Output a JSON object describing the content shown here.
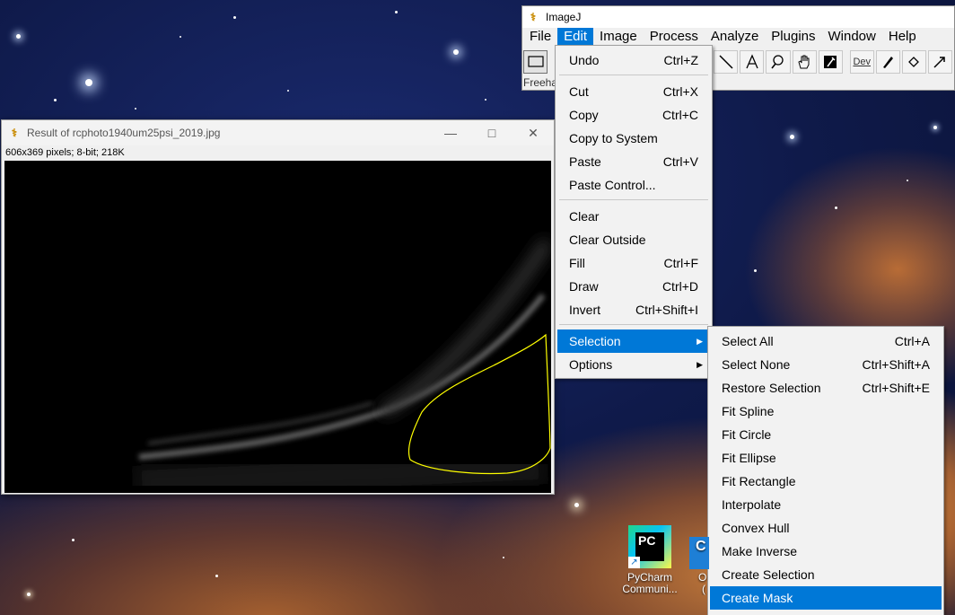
{
  "imagej": {
    "title": "ImageJ",
    "menus": [
      "File",
      "Edit",
      "Image",
      "Process",
      "Analyze",
      "Plugins",
      "Window",
      "Help"
    ],
    "active_menu": "Edit",
    "status_text": "Freeha",
    "tools": [
      "rectangle",
      "straight-line",
      "text",
      "magnifier",
      "hand",
      "color-picker",
      "dev",
      "brush",
      "flood-fill",
      "arrow"
    ],
    "dev_label": "Dev"
  },
  "image_window": {
    "title": "Result of rcphoto1940um25psi_2019.jpg",
    "info": "606x369 pixels; 8-bit; 218K"
  },
  "edit_menu": [
    {
      "label": "Undo",
      "shortcut": "Ctrl+Z"
    },
    {
      "label": "Cut",
      "shortcut": "Ctrl+X"
    },
    {
      "label": "Copy",
      "shortcut": "Ctrl+C"
    },
    {
      "label": "Copy to System",
      "shortcut": ""
    },
    {
      "label": "Paste",
      "shortcut": "Ctrl+V"
    },
    {
      "label": "Paste Control...",
      "shortcut": ""
    },
    {
      "label": "Clear",
      "shortcut": ""
    },
    {
      "label": "Clear Outside",
      "shortcut": ""
    },
    {
      "label": "Fill",
      "shortcut": "Ctrl+F"
    },
    {
      "label": "Draw",
      "shortcut": "Ctrl+D"
    },
    {
      "label": "Invert",
      "shortcut": "Ctrl+Shift+I"
    },
    {
      "label": "Selection",
      "shortcut": ""
    },
    {
      "label": "Options",
      "shortcut": ""
    }
  ],
  "selection_menu": [
    {
      "label": "Select All",
      "shortcut": "Ctrl+A"
    },
    {
      "label": "Select None",
      "shortcut": "Ctrl+Shift+A"
    },
    {
      "label": "Restore Selection",
      "shortcut": "Ctrl+Shift+E"
    },
    {
      "label": "Fit Spline",
      "shortcut": ""
    },
    {
      "label": "Fit Circle",
      "shortcut": ""
    },
    {
      "label": "Fit Ellipse",
      "shortcut": ""
    },
    {
      "label": "Fit Rectangle",
      "shortcut": ""
    },
    {
      "label": "Interpolate",
      "shortcut": ""
    },
    {
      "label": "Convex Hull",
      "shortcut": ""
    },
    {
      "label": "Make Inverse",
      "shortcut": ""
    },
    {
      "label": "Create Selection",
      "shortcut": ""
    },
    {
      "label": "Create Mask",
      "shortcut": ""
    }
  ],
  "desktop": {
    "pycharm_badge": "PC",
    "pycharm_label_1": "PyCharm",
    "pycharm_label_2": "Communi...",
    "second_badge": "C",
    "second_label_1": "O",
    "second_label_2": "("
  },
  "colors": {
    "highlight": "#0078d7",
    "selection_roi": "#ffff00"
  }
}
